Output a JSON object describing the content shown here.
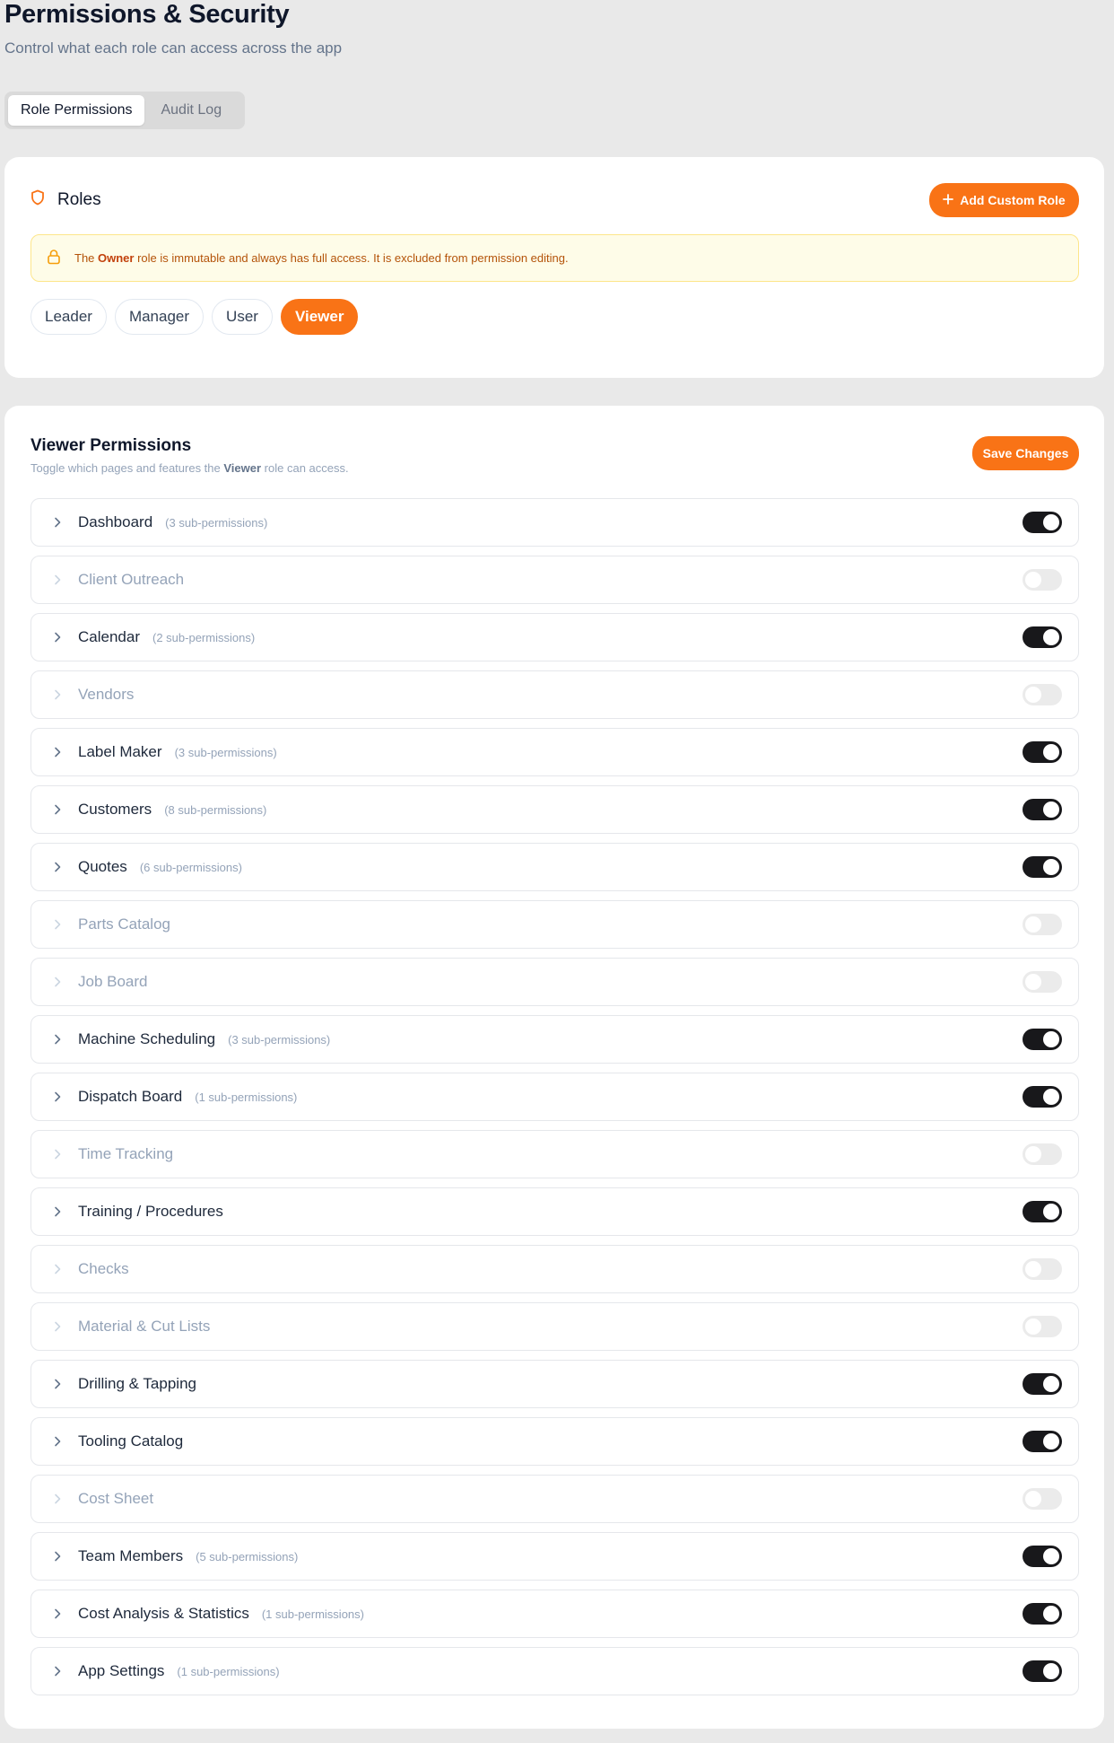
{
  "header": {
    "title": "Permissions & Security",
    "subtitle": "Control what each role can access across the app"
  },
  "tabs": [
    {
      "label": "Role Permissions",
      "active": true
    },
    {
      "label": "Audit Log",
      "active": false
    }
  ],
  "roles_card": {
    "title": "Roles",
    "add_button": "Add Custom Role",
    "notice": {
      "prefix": "The ",
      "bold": "Owner",
      "suffix": " role is immutable and always has full access. It is excluded from permission editing."
    },
    "roles": [
      {
        "label": "Leader",
        "active": false
      },
      {
        "label": "Manager",
        "active": false
      },
      {
        "label": "User",
        "active": false
      },
      {
        "label": "Viewer",
        "active": true
      }
    ]
  },
  "permissions_card": {
    "title": "Viewer Permissions",
    "desc_prefix": "Toggle which pages and features the ",
    "desc_bold": "Viewer",
    "desc_suffix": " role can access.",
    "save_button": "Save Changes",
    "items": [
      {
        "name": "Dashboard",
        "sub": "(3 sub-permissions)",
        "enabled": true
      },
      {
        "name": "Client Outreach",
        "sub": "",
        "enabled": false
      },
      {
        "name": "Calendar",
        "sub": "(2 sub-permissions)",
        "enabled": true
      },
      {
        "name": "Vendors",
        "sub": "",
        "enabled": false
      },
      {
        "name": "Label Maker",
        "sub": "(3 sub-permissions)",
        "enabled": true
      },
      {
        "name": "Customers",
        "sub": "(8 sub-permissions)",
        "enabled": true
      },
      {
        "name": "Quotes",
        "sub": "(6 sub-permissions)",
        "enabled": true
      },
      {
        "name": "Parts Catalog",
        "sub": "",
        "enabled": false
      },
      {
        "name": "Job Board",
        "sub": "",
        "enabled": false
      },
      {
        "name": "Machine Scheduling",
        "sub": "(3 sub-permissions)",
        "enabled": true
      },
      {
        "name": "Dispatch Board",
        "sub": "(1 sub-permissions)",
        "enabled": true
      },
      {
        "name": "Time Tracking",
        "sub": "",
        "enabled": false
      },
      {
        "name": "Training / Procedures",
        "sub": "",
        "enabled": true
      },
      {
        "name": "Checks",
        "sub": "",
        "enabled": false
      },
      {
        "name": "Material & Cut Lists",
        "sub": "",
        "enabled": false
      },
      {
        "name": "Drilling & Tapping",
        "sub": "",
        "enabled": true
      },
      {
        "name": "Tooling Catalog",
        "sub": "",
        "enabled": true
      },
      {
        "name": "Cost Sheet",
        "sub": "",
        "enabled": false
      },
      {
        "name": "Team Members",
        "sub": "(5 sub-permissions)",
        "enabled": true
      },
      {
        "name": "Cost Analysis & Statistics",
        "sub": "(1 sub-permissions)",
        "enabled": true
      },
      {
        "name": "App Settings",
        "sub": "(1 sub-permissions)",
        "enabled": true
      }
    ]
  },
  "colors": {
    "accent": "#f97316",
    "toggle_on": "#18181b",
    "toggle_off": "#ebebeb",
    "notice_bg": "#fefce8",
    "notice_text": "#b45309"
  }
}
